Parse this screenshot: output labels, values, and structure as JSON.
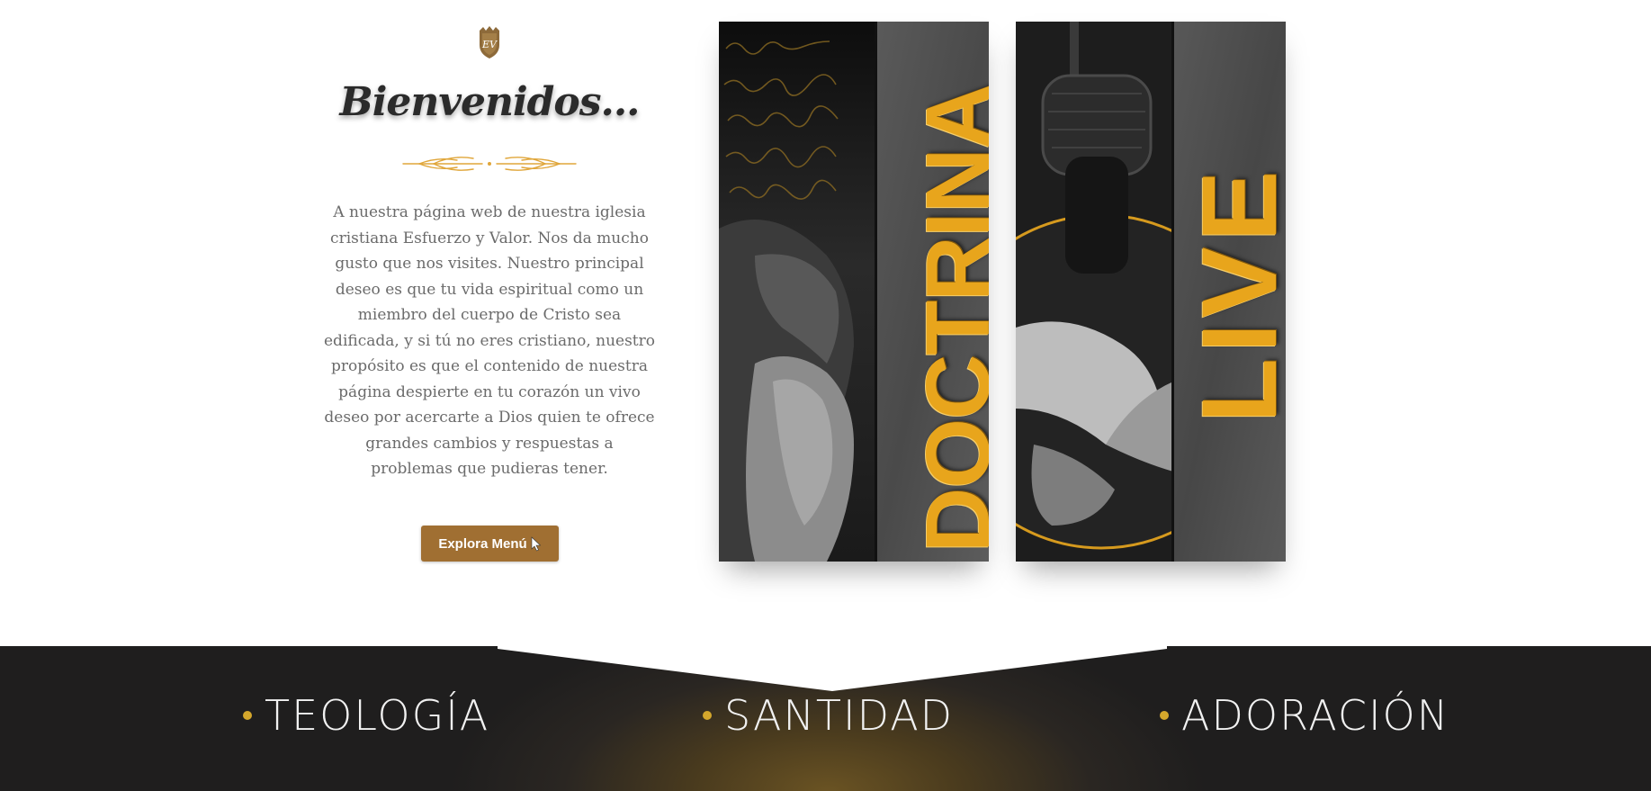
{
  "welcome": {
    "logo_icon": "ev-crest-icon",
    "logo_monogram": "EV",
    "title": "Bienvenidos...",
    "ornament_icon": "wheat-ornament-icon",
    "text": "A nuestra página web de nuestra iglesia cristiana Esfuerzo y Valor. Nos da mucho gusto que nos visites. Nuestro principal deseo es que tu vida espiritual como un miembro del cuerpo de Cristo sea edificada, y si tú no eres cristiano, nuestro propósito es que el contenido de nuestra página despierte en tu corazón un vivo deseo por acercarte a Dios quien te ofrece grandes cambios y respuestas a problemas que pudieras tener.",
    "button_label": "Explora Menú",
    "button_icon": "cursor-icon"
  },
  "cards": [
    {
      "title": "DOCTRINA",
      "image": "praying-man-photo"
    },
    {
      "title": "LIVE",
      "image": "microphone-bible-photo"
    }
  ],
  "values": [
    {
      "label": "TEOLOGÍA"
    },
    {
      "label": "SANTIDAD"
    },
    {
      "label": "ADORACIÓN"
    }
  ],
  "colors": {
    "accent_brown": "#a06f32",
    "gold": "#e8a51c",
    "dot_gold": "#d4a72c",
    "band_dark": "#1f1e1e",
    "text_gray": "#6b6b6b",
    "title_dark": "#2b2b2b"
  }
}
